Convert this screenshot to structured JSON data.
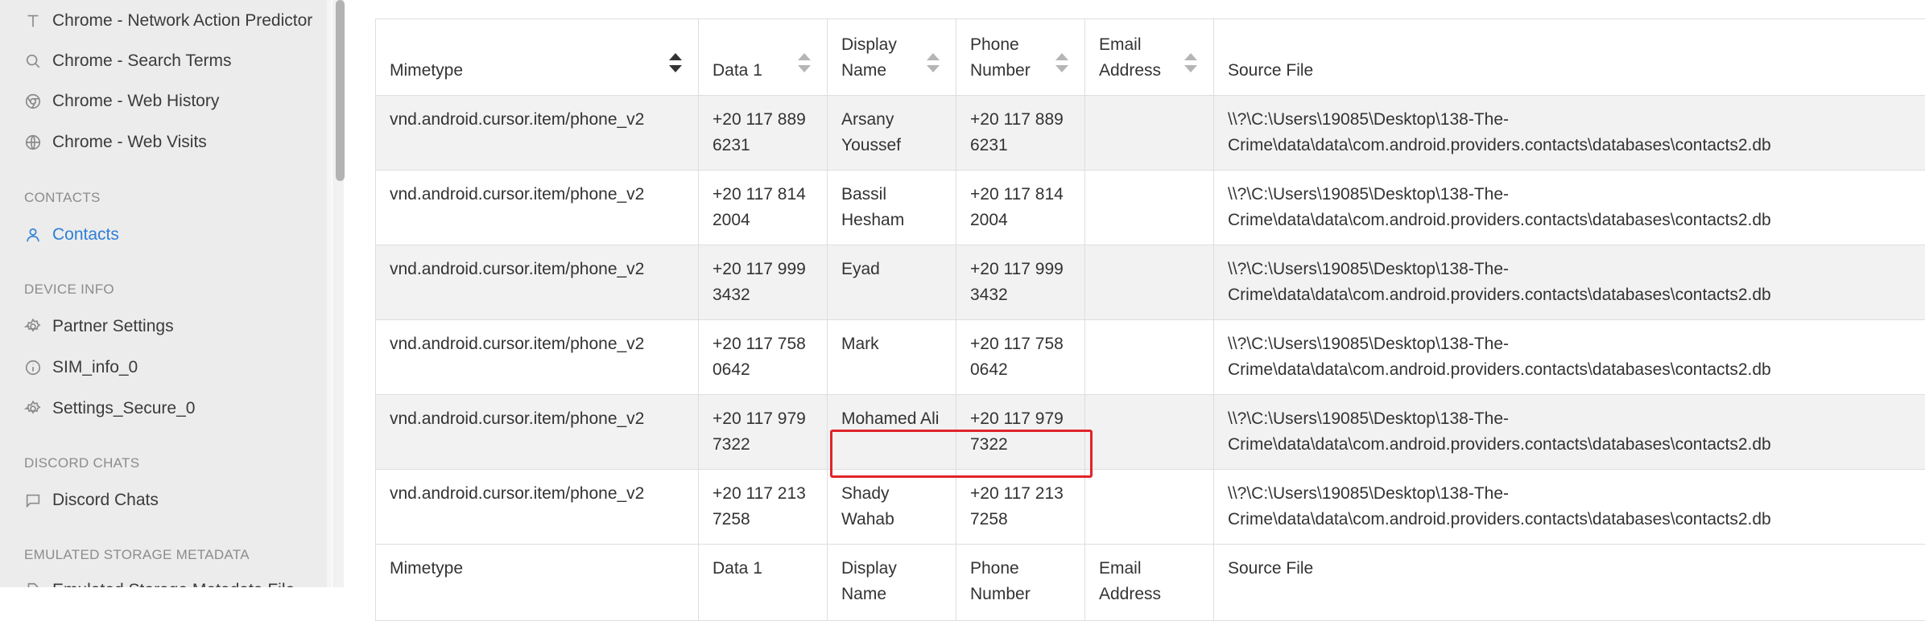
{
  "sidebar": {
    "items_top": [
      {
        "label": "Chrome - Network Action Predictor",
        "icon": "text-icon"
      },
      {
        "label": "Chrome - Search Terms",
        "icon": "search-icon"
      },
      {
        "label": "Chrome - Web History",
        "icon": "chrome-icon"
      },
      {
        "label": "Chrome - Web Visits",
        "icon": "globe-icon"
      }
    ],
    "sections": [
      {
        "title": "CONTACTS",
        "items": [
          {
            "label": "Contacts",
            "icon": "person-icon",
            "active": true
          }
        ]
      },
      {
        "title": "DEVICE INFO",
        "items": [
          {
            "label": "Partner Settings",
            "icon": "gear-icon"
          },
          {
            "label": "SIM_info_0",
            "icon": "info-icon"
          },
          {
            "label": "Settings_Secure_0",
            "icon": "gear-icon"
          }
        ]
      },
      {
        "title": "DISCORD CHATS",
        "items": [
          {
            "label": "Discord Chats",
            "icon": "chat-icon"
          }
        ]
      },
      {
        "title": "EMULATED STORAGE METADATA",
        "items": [
          {
            "label": "Emulated Storage Metadata File",
            "icon": "file-icon"
          }
        ]
      }
    ]
  },
  "table": {
    "headers": [
      "Mimetype",
      "Data 1",
      "Display Name",
      "Phone Number",
      "Email Address",
      "Source File"
    ],
    "sorted_column": "Mimetype",
    "rows": [
      [
        "vnd.android.cursor.item/phone_v2",
        "+20 117 889 6231",
        "Arsany Youssef",
        "+20 117 889 6231",
        "",
        "\\\\?\\C:\\Users\\19085\\Desktop\\138-The-Crime\\data\\data\\com.android.providers.contacts\\databases\\contacts2.db"
      ],
      [
        "vnd.android.cursor.item/phone_v2",
        "+20 117 814 2004",
        "Bassil Hesham",
        "+20 117 814 2004",
        "",
        "\\\\?\\C:\\Users\\19085\\Desktop\\138-The-Crime\\data\\data\\com.android.providers.contacts\\databases\\contacts2.db"
      ],
      [
        "vnd.android.cursor.item/phone_v2",
        "+20 117 999 3432",
        "Eyad",
        "+20 117 999 3432",
        "",
        "\\\\?\\C:\\Users\\19085\\Desktop\\138-The-Crime\\data\\data\\com.android.providers.contacts\\databases\\contacts2.db"
      ],
      [
        "vnd.android.cursor.item/phone_v2",
        "+20 117 758 0642",
        "Mark",
        "+20 117 758 0642",
        "",
        "\\\\?\\C:\\Users\\19085\\Desktop\\138-The-Crime\\data\\data\\com.android.providers.contacts\\databases\\contacts2.db"
      ],
      [
        "vnd.android.cursor.item/phone_v2",
        "+20 117 979 7322",
        "Mohamed Ali",
        "+20 117 979 7322",
        "",
        "\\\\?\\C:\\Users\\19085\\Desktop\\138-The-Crime\\data\\data\\com.android.providers.contacts\\databases\\contacts2.db"
      ],
      [
        "vnd.android.cursor.item/phone_v2",
        "+20 117 213 7258",
        "Shady Wahab",
        "+20 117 213 7258",
        "",
        "\\\\?\\C:\\Users\\19085\\Desktop\\138-The-Crime\\data\\data\\com.android.providers.contacts\\databases\\contacts2.db"
      ]
    ],
    "footer": [
      "Mimetype",
      "Data 1",
      "Display Name",
      "Phone Number",
      "Email Address",
      "Source File"
    ]
  },
  "colors": {
    "accent": "#2f7fd6",
    "highlight": "#e0242b"
  }
}
